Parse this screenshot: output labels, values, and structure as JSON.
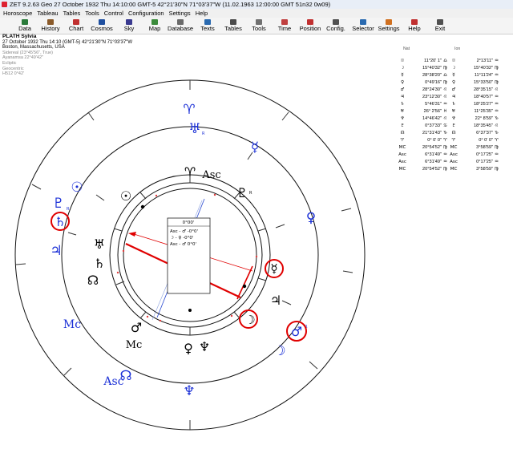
{
  "window": {
    "title": "ZET 9.2.63 Geo    27 October 1932  Thu   14:10:00 GMT-5 42°21'30\"N  71°03'37\"W  (11.02.1963  12:00:00 GMT 51n32 0w09)"
  },
  "menu": [
    "Horoscope",
    "Tableau",
    "Tables",
    "Tools",
    "Control",
    "Configuration",
    "Settings",
    "Help"
  ],
  "toolbar": [
    {
      "label": "Data",
      "icon": "data-icon",
      "color": "#2a7a3a"
    },
    {
      "label": "History",
      "icon": "history-icon",
      "color": "#8a5a2a"
    },
    {
      "label": "Chart",
      "icon": "chart-icon",
      "color": "#c03030"
    },
    {
      "label": "Cosmos",
      "icon": "cosmos-icon",
      "color": "#2050a0"
    },
    {
      "label": "Sky",
      "icon": "sky-icon",
      "color": "#3a3a90"
    },
    {
      "label": "Map",
      "icon": "map-icon",
      "color": "#3a8a3a"
    },
    {
      "label": "Database",
      "icon": "database-icon",
      "color": "#6a6a6a"
    },
    {
      "label": "Texts",
      "icon": "texts-icon",
      "color": "#2a6ab0"
    },
    {
      "label": "Tables",
      "icon": "tables-icon",
      "color": "#4a4a4a"
    },
    {
      "label": "Tools",
      "icon": "tools-icon",
      "color": "#707070"
    },
    {
      "label": "Time",
      "icon": "time-icon",
      "color": "#c04040"
    },
    {
      "label": "Position",
      "icon": "position-icon",
      "color": "#c03030"
    },
    {
      "label": "Config.",
      "icon": "config-icon",
      "color": "#505050"
    },
    {
      "label": "Selector",
      "icon": "selector-icon",
      "color": "#2a6ab0"
    },
    {
      "label": "Settings",
      "icon": "settings-icon",
      "color": "#d07020"
    },
    {
      "label": "Help",
      "icon": "help-icon",
      "color": "#c03030"
    },
    {
      "label": "Exit",
      "icon": "exit-icon",
      "color": "#505050"
    }
  ],
  "chart_info": {
    "name": "PLATH Sylvia",
    "datetime": "27 October 1932  Thu  14:10 (GMT-5) 42°21'30\"N  71°03'37\"W",
    "place": "Boston, Massachusetts, USA",
    "extra": [
      "Sidereal (23°45'56\", True)",
      "Ayanamsa 22°49'42\"",
      "Ecliptic",
      "Geocentric",
      "",
      "H512   0°42'"
    ]
  },
  "wheel": {
    "center_box": {
      "header": "0°00'",
      "lines": [
        "Asc - ♂   -0°0'",
        "☽ - ♀   -0°0'",
        "Asc - ♂    0°0'"
      ]
    },
    "inner_labels": {
      "asc": "Asc",
      "mc": "Mc"
    },
    "outer_labels": {
      "asc": "Asc",
      "mc": "Mc"
    },
    "retro": "R",
    "colors": {
      "outer": "#1a2fd6",
      "inner": "#000000",
      "highlight": "#e00000"
    }
  },
  "table": {
    "col1": "Nat",
    "col2": "Ion",
    "rows": [
      {
        "g1": "☉",
        "v1": "11°20' 1\"",
        "s1": "♎",
        "g2": "☉",
        "v2": "2°13'11\"",
        "s2": "♒"
      },
      {
        "g1": "☽",
        "v1": "15°40'32\"",
        "s1": "♍",
        "g2": "☽",
        "v2": "15°40'32\"",
        "s2": "♍"
      },
      {
        "g1": "☿",
        "v1": "28°38'20\"",
        "s1": "♎",
        "g2": "☿",
        "v2": "11°11'24\"",
        "s2": "♒"
      },
      {
        "g1": "♀",
        "v1": "0°49'16\"",
        "s1": "♍",
        "g2": "♀",
        "v2": "15°33'50\"",
        "s2": "♍"
      },
      {
        "g1": "♂",
        "v1": "28°24'30\"",
        "s1": "♌",
        "g2": "♂",
        "v2": "28°35'15\"",
        "s2": "♌"
      },
      {
        "g1": "♃",
        "v1": "23°12'30\"",
        "s1": "♌",
        "g2": "♃",
        "v2": "18°40'57\"",
        "s2": "♒"
      },
      {
        "g1": "♄",
        "v1": "5°46'31\"",
        "s1": "♒",
        "g2": "♄",
        "v2": "18°25'27\"",
        "s2": "♒"
      },
      {
        "g1": "♅",
        "v1": "26° 2'56\"",
        "s1": "♓",
        "g2": "♅",
        "v2": "11°25'35\"",
        "s2": "♒"
      },
      {
        "g1": "♆",
        "v1": "14°46'42\"",
        "s1": "♌",
        "g2": "♆",
        "v2": "22° 8'59\"",
        "s2": "♑"
      },
      {
        "g1": "♇",
        "v1": "0°37'33\"",
        "s1": "♋",
        "g2": "♇",
        "v2": "18°35'45\"",
        "s2": "♌"
      },
      {
        "g1": "☊",
        "v1": "21°31'43\"",
        "s1": "♑",
        "g2": "☊",
        "v2": "6°37'37\"",
        "s2": "♑"
      },
      {
        "g1": "♈",
        "v1": "0° 0' 0\"",
        "s1": "♈",
        "g2": "♈",
        "v2": "0° 0' 0\"",
        "s2": "♈"
      },
      {
        "g1": "MC",
        "v1": "20°54'52\"",
        "s1": "♍",
        "g2": "MC",
        "v2": "3°58'59\"",
        "s2": "♍"
      },
      {
        "g1": "Asc",
        "v1": "6°31'49\"",
        "s1": "♒",
        "g2": "Asc",
        "v2": "0°17'25\"",
        "s2": "♒"
      },
      {
        "g1": "Asc",
        "v1": "6°31'49\"",
        "s1": "♒",
        "g2": "Asc",
        "v2": "0°17'25\"",
        "s2": "♒"
      },
      {
        "g1": "MC",
        "v1": "20°54'52\"",
        "s1": "♍",
        "g2": "MC",
        "v2": "3°58'59\"",
        "s2": "♍"
      }
    ]
  }
}
